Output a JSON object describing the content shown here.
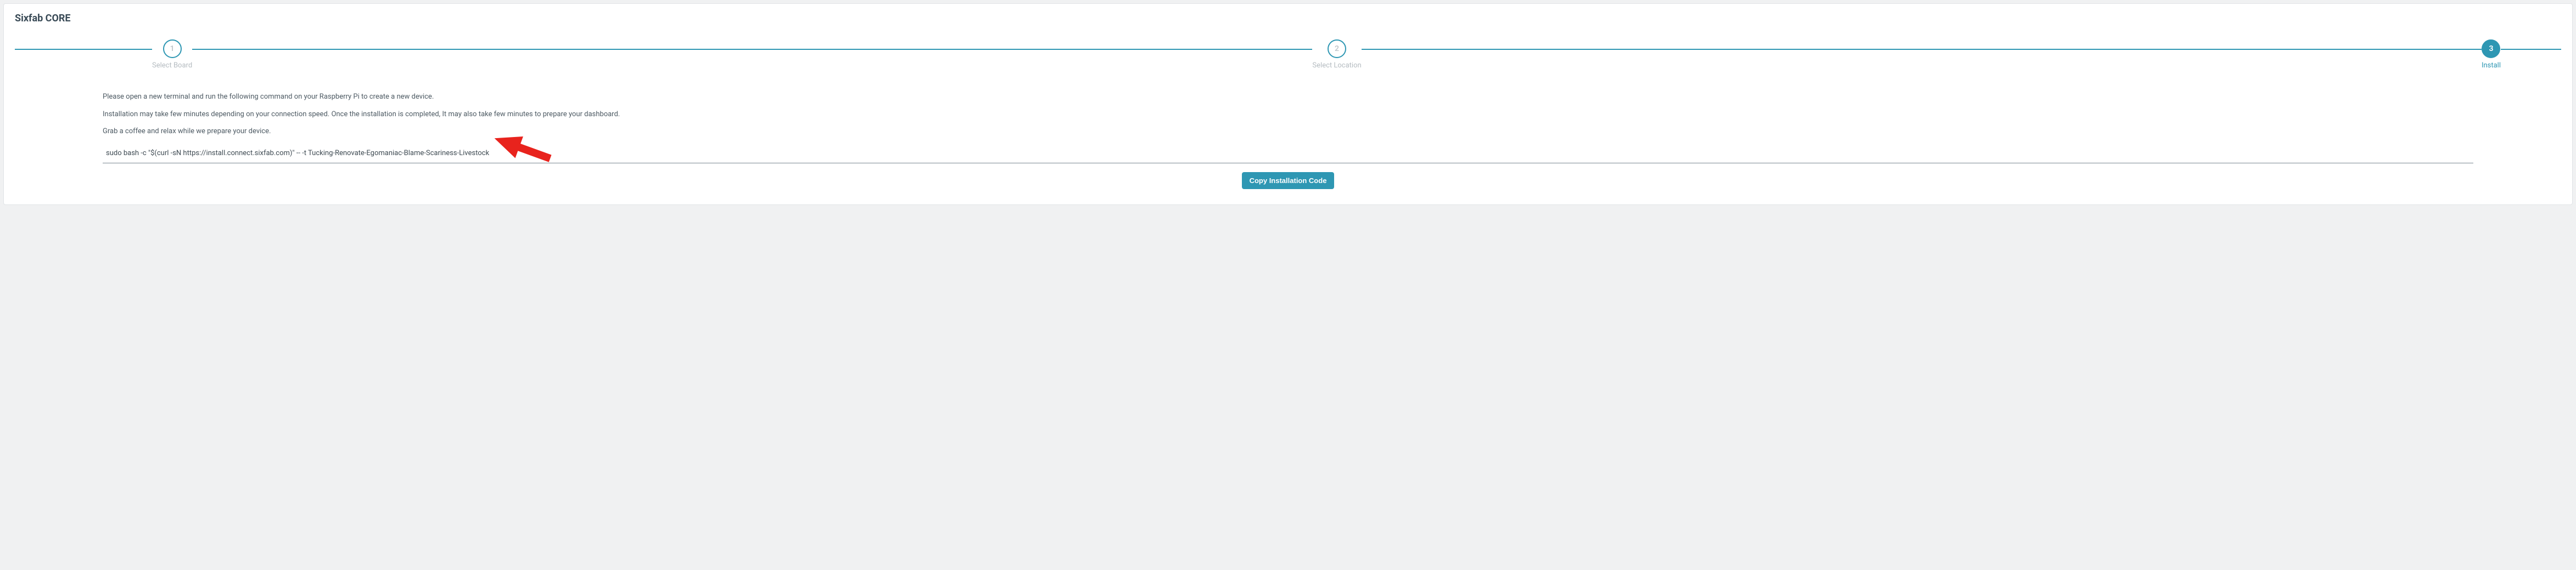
{
  "title": "Sixfab CORE",
  "stepper": {
    "steps": [
      {
        "number": "1",
        "label": "Select Board",
        "active": false
      },
      {
        "number": "2",
        "label": "Select Location",
        "active": false
      },
      {
        "number": "3",
        "label": "Install",
        "active": true
      }
    ]
  },
  "instructions": {
    "line1": "Please open a new terminal and run the following command on your Raspberry Pi to create a new device.",
    "line2": "Installation may take few minutes depending on your connection speed. Once the installation is completed, It may also take few minutes to prepare your dashboard.",
    "line3": "Grab a coffee and relax while we prepare your device."
  },
  "command": "sudo bash -c \"$(curl -sN https://install.connect.sixfab.com)\" -- -t Tucking-Renovate-Egomaniac-Blame-Scariness-Livestock",
  "copy_button_label": "Copy Installation Code"
}
